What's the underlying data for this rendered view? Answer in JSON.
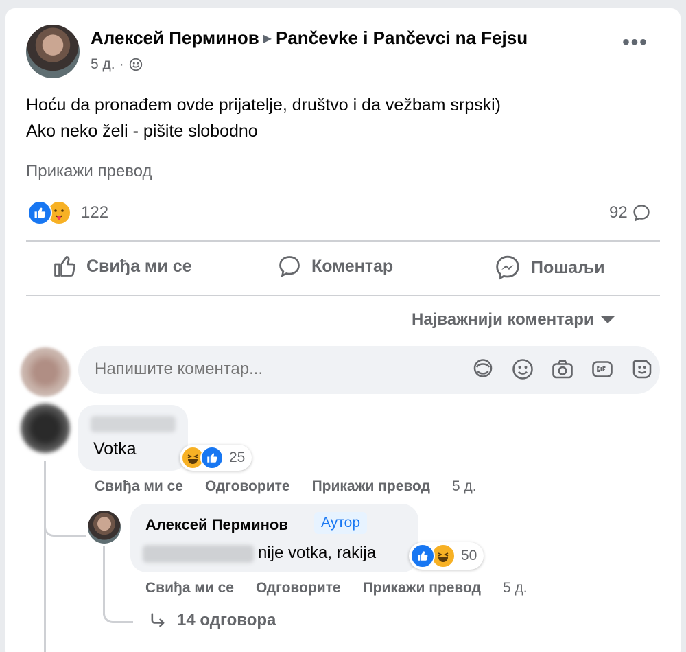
{
  "post": {
    "author": "Алексей Перминов",
    "group": "Pančevke i Pančevci na Fejsu",
    "time": "5 д.",
    "time_separator": "·",
    "more_label": "•••",
    "text_line1": "Hoću da pronađem ovde prijatelje, društvo i da vežbam srpski)",
    "text_line2": "Ako neko želi - pišite slobodno",
    "show_translation": "Прикажи превод",
    "reaction_count": "122",
    "comment_count": "92"
  },
  "actions": {
    "like": "Свиђа ми се",
    "comment": "Коментар",
    "share": "Пошаљи"
  },
  "sort_label": "Најважнији коментари",
  "composer": {
    "placeholder": "Напишите коментар..."
  },
  "comments": [
    {
      "text": "Votka",
      "reaction_count": "25",
      "like": "Свиђа ми се",
      "reply": "Одговорите",
      "translate": "Прикажи превод",
      "time": "5 д."
    }
  ],
  "reply": {
    "author": "Алексей Перминов",
    "badge": "Аутор",
    "text": "nije votka, rakija",
    "reaction_count": "50",
    "like": "Свиђа ми се",
    "reply": "Одговорите",
    "translate": "Прикажи превод",
    "time": "5 д."
  },
  "more_replies": "14 одговора",
  "colors": {
    "accent": "#1877f2",
    "secondary_text": "#65676b",
    "bubble": "#f0f2f5"
  }
}
